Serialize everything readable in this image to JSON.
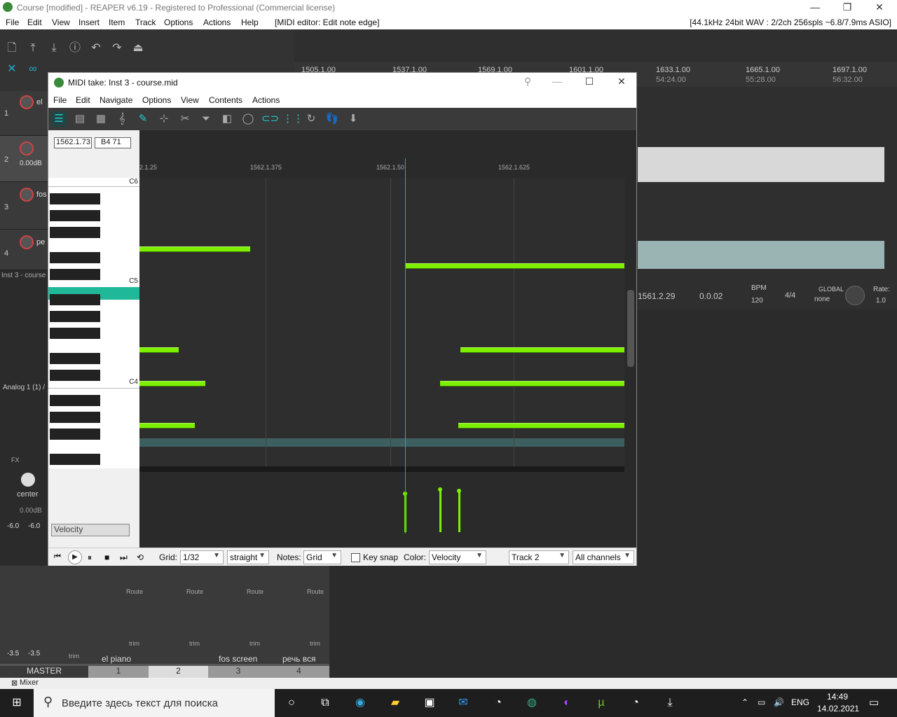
{
  "window": {
    "title": "Course [modified] - REAPER v6.19 - Registered to Professional (Commercial license)"
  },
  "menu": [
    "File",
    "Edit",
    "View",
    "Insert",
    "Item",
    "Track",
    "Options",
    "Actions",
    "Help",
    "[MIDI editor: Edit note edge]"
  ],
  "status": "[44.1kHz 24bit WAV : 2/2ch 256spls ~6.8/7.9ms ASIO]",
  "ruler": {
    "bars": [
      "1505.1.00",
      "1537.1.00",
      "1569.1.00",
      "1601.1.00",
      "1633.1.00",
      "1665.1.00",
      "1697.1.00"
    ],
    "times": [
      "54:24.00",
      "55:28.00",
      "56:32.00"
    ]
  },
  "tracks": [
    {
      "num": "1",
      "name": "el"
    },
    {
      "num": "2",
      "name": "",
      "vol": "0.00dB"
    },
    {
      "num": "3",
      "name": "fos"
    },
    {
      "num": "4",
      "name": "pe"
    }
  ],
  "track_panel_labels": {
    "inst_label": "Inst 3 - course",
    "analog": "Analog 1 (1) /",
    "fx": "FX",
    "center": "center",
    "db": "0.00dB"
  },
  "transport": {
    "pos": "1561.2.29",
    "len": "0.0.02",
    "bpm_label": "BPM",
    "bpm": "120",
    "sig": "4/4",
    "global": "GLOBAL",
    "none": "none",
    "rate_label": "Rate:",
    "rate": "1.0"
  },
  "midi": {
    "title": "MIDI take: Inst 3 - course.mid",
    "menu": [
      "File",
      "Edit",
      "Navigate",
      "Options",
      "View",
      "Contents",
      "Actions"
    ],
    "position": "1562.1.73",
    "note": "B4  71",
    "ruler": [
      "2.1.25",
      "1562.1.375",
      "1562.1.50",
      "1562.1.625"
    ],
    "key_labels": [
      "C6",
      "C5",
      "C4"
    ],
    "lane": "Velocity",
    "grid_label": "Grid:",
    "grid": "1/32",
    "swing": "straight",
    "notes_label": "Notes:",
    "notes": "Grid",
    "keysnap": "Key snap",
    "color_label": "Color:",
    "color": "Velocity",
    "track": "Track 2",
    "channels": "All channels"
  },
  "mixer": {
    "channels": [
      "el piano",
      "fos screen",
      "речь вся"
    ],
    "tabs": [
      "MASTER",
      "1",
      "2",
      "3",
      "4"
    ],
    "route": "Route",
    "trim": "trim",
    "meters": [
      "-6.0",
      "-6.0",
      "-3.5",
      "-3.5"
    ],
    "bar_label": "Mixer"
  },
  "taskbar": {
    "search": "Введите здесь текст для поиска",
    "lang": "ENG",
    "time": "14:49",
    "date": "14.02.2021"
  }
}
